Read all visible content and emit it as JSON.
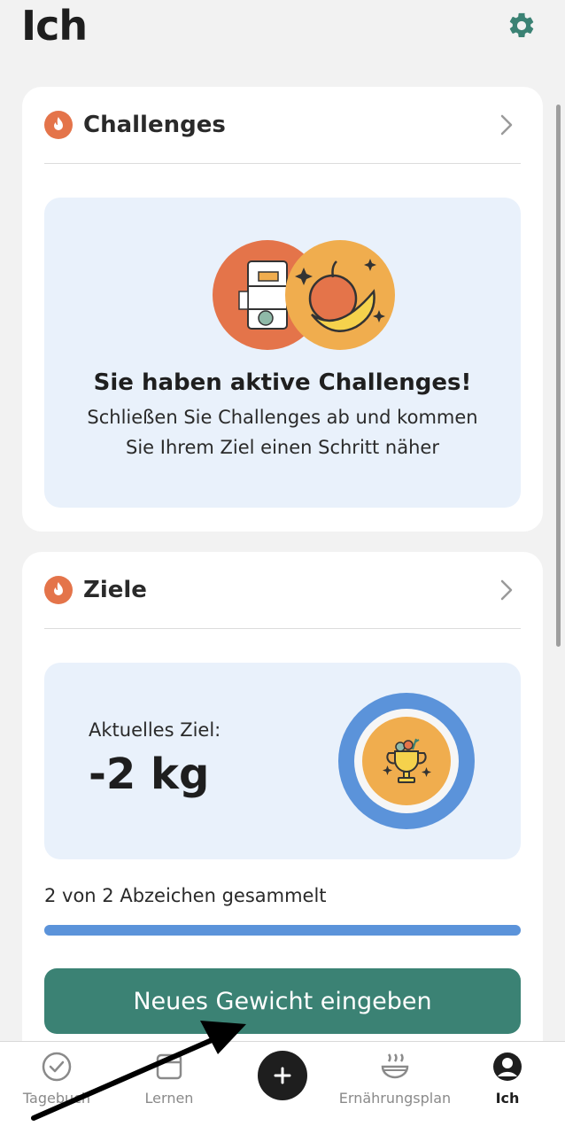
{
  "header": {
    "title": "Ich",
    "settings_icon": "gear-icon"
  },
  "colors": {
    "accent_green": "#3b8274",
    "accent_blue": "#5b93da",
    "flame_orange": "#e4744a",
    "panel_blue": "#e9f1fb"
  },
  "challenges": {
    "title": "Challenges",
    "heading": "Sie haben aktive Challenges!",
    "subtitle_line1": "Schließen Sie Challenges ab und kommen",
    "subtitle_line2": "Sie Ihrem Ziel einen Schritt näher"
  },
  "goals": {
    "title": "Ziele",
    "current_goal_label": "Aktuelles Ziel:",
    "current_goal_value": "-2 kg",
    "badges_text": "2 von 2 Abzeichen gesammelt",
    "badges_collected": 2,
    "badges_total": 2,
    "button_label": "Neues Gewicht eingeben"
  },
  "tabs": [
    {
      "label": "Tagebuch",
      "icon": "check-circle-icon",
      "active": false
    },
    {
      "label": "Lernen",
      "icon": "book-icon",
      "active": false
    },
    {
      "label": "",
      "icon": "plus-icon",
      "active": false
    },
    {
      "label": "Ernährungsplan",
      "icon": "food-bowl-icon",
      "active": false
    },
    {
      "label": "Ich",
      "icon": "profile-icon",
      "active": true
    }
  ]
}
